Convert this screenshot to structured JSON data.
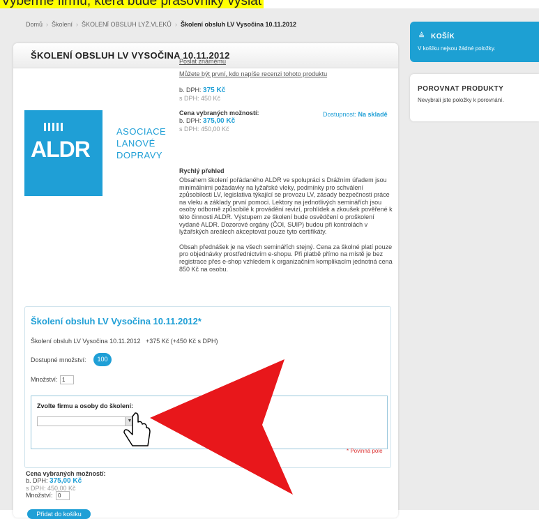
{
  "banner": "Vyberme firmu, ktera bude prasovniky vyslat",
  "breadcrumb": [
    "Domů",
    "Školení",
    "ŠKOLENÍ OBSLUH LYŽ.VLEKŮ",
    "Školení obsluh LV Vysočina 10.11.2012"
  ],
  "product": {
    "title": "ŠKOLENÍ OBSLUH LV VYSOČINA 10.11.2012",
    "logo": {
      "mark": "ALDR",
      "line1": "ASOCIACE",
      "line2": "LANOVÉ",
      "line3": "DOPRAVY"
    },
    "send_friend": "Poslat známému",
    "review": "Můžete být první, kdo napíše recenzi tohoto produktu",
    "price_b_label": "b. DPH:",
    "price_b": "375 Kč",
    "price_s": "s DPH: 450 Kč",
    "availability_label": "Dostupnost:",
    "availability": "Na skladě",
    "selected_label": "Cena vybraných možností:",
    "selected_b_label": "b. DPH:",
    "selected_b": "375,00 Kč",
    "selected_s": "s DPH: 450,00 Kč",
    "overview_heading": "Rychlý přehled",
    "overview_p1": "Obsahem školení pořádaného ALDR ve spolupráci s Drážním úřadem jsou minimálními požadavky na lyžařské vleky, podmínky pro schválení způsobilosti LV, legislativa týkající se provozu LV, zásady bezpečnosti práce na vleku a základy první pomoci. Lektory na jednotlivých seminářích jsou osoby odborně způsobilé k provádění revizí, prohlídek a zkoušek pověřené k této činnosti ALDR. Výstupem ze školení bude osvědčení o proškolení vydané ALDR. Dozorové orgány (ČOI, SUIP) budou při kontrolách v lyžařských areálech akceptovat pouze tyto certifikáty.",
    "overview_p2": "Obsah přednášek je na všech seminářích stejný. Cena za školné platí pouze pro objednávky prostřednictvím e-shopu. Při platbě přímo na místě je bez registrace přes e-shop vzhledem k organizačním komplikacím jednotná cena 850 Kč na osobu."
  },
  "options": {
    "heading": "Školení obsluh LV Vysočina 10.11.2012*",
    "item": "Školení obsluh LV Vysočina 10.11.2012",
    "item_price": "+375 Kč (+450 Kč s DPH)",
    "available_label": "Dostupné množství:",
    "available_qty": "100",
    "qty_label": "Množství:",
    "qty_value": "1",
    "select_label": "Zvolte firmu a osoby do školení:",
    "required": "* Povinná pole"
  },
  "summary": {
    "label": "Cena vybraných možností:",
    "b_label": "b. DPH:",
    "b_value": "375,00 Kč",
    "s_value": "s DPH: 450,00 Kč",
    "qty_label": "Množství:",
    "qty_value": "0",
    "add_button": "Přidat do košíku"
  },
  "cart": {
    "title": "KOŠÍK",
    "empty": "V košíku nejsou žádné položky."
  },
  "compare": {
    "title": "POROVNAT PRODUKTY",
    "empty": "Nevybrali jste položky k porovnání."
  },
  "colors": {
    "accent": "#1f9fd6",
    "arrow": "#e8171b",
    "banner": "#ffff00"
  }
}
